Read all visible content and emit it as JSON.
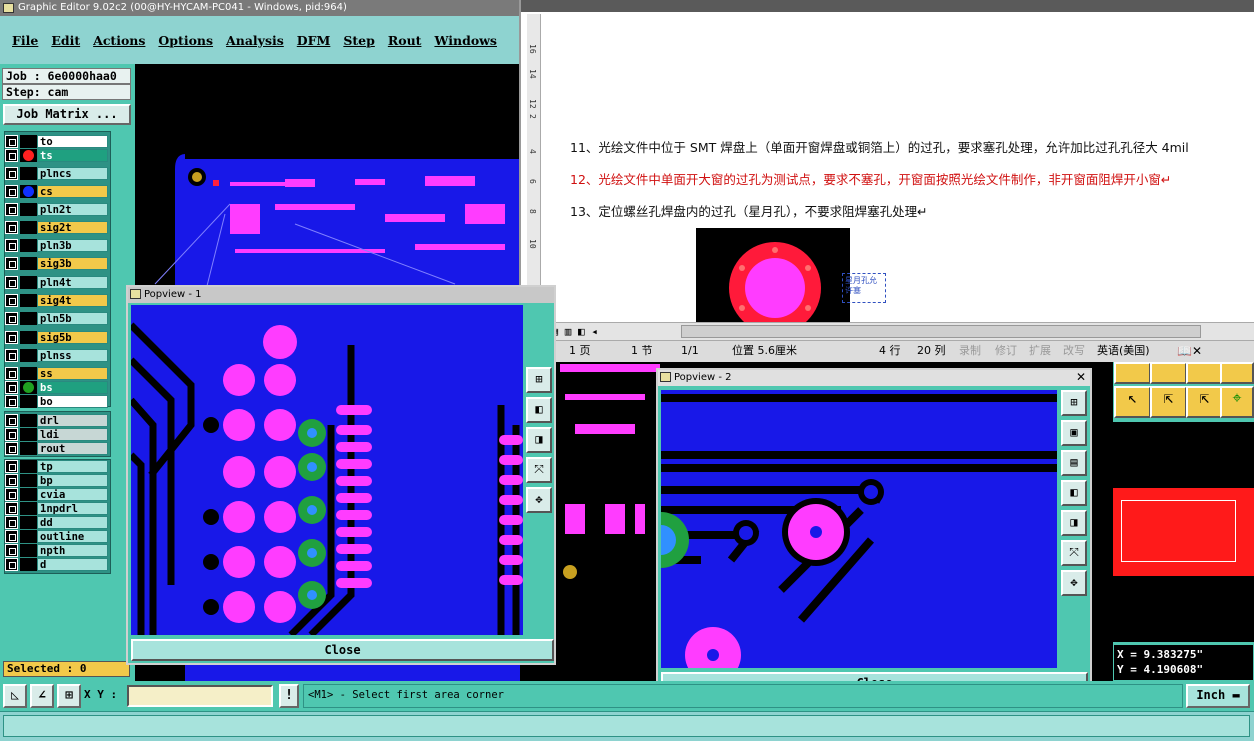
{
  "app": {
    "title": "Graphic Editor 9.02c2 (00@HY-HYCAM-PC041 - Windows, pid:964)"
  },
  "menu": [
    "File",
    "Edit",
    "Actions",
    "Options",
    "Analysis",
    "DFM",
    "Step",
    "Rout",
    "Windows"
  ],
  "job": {
    "job_label": "Job : 6e0000haa0",
    "step_label": "Step: cam",
    "matrix_button": "Job Matrix ..."
  },
  "layers": [
    {
      "name": "to",
      "style": "w",
      "color": "#000000"
    },
    {
      "name": "ts",
      "style": "g",
      "color": "#ff2020"
    },
    {
      "name": "plncs",
      "style": "n",
      "color": "#000000"
    },
    {
      "name": "cs",
      "style": "y",
      "color": "#1030ff"
    },
    {
      "name": "pln2t",
      "style": "n",
      "color": "#000000"
    },
    {
      "name": "sig2t",
      "style": "y",
      "color": "#000000"
    },
    {
      "name": "pln3b",
      "style": "n",
      "color": "#000000"
    },
    {
      "name": "sig3b",
      "style": "y",
      "color": "#000000"
    },
    {
      "name": "pln4t",
      "style": "n",
      "color": "#000000"
    },
    {
      "name": "sig4t",
      "style": "y",
      "color": "#000000"
    },
    {
      "name": "pln5b",
      "style": "n",
      "color": "#000000"
    },
    {
      "name": "sig5b",
      "style": "y",
      "color": "#000000"
    },
    {
      "name": "plnss",
      "style": "n",
      "color": "#000000"
    },
    {
      "name": "ss",
      "style": "y",
      "color": "#000000"
    },
    {
      "name": "bs",
      "style": "g",
      "color": "#20a020"
    },
    {
      "name": "bo",
      "style": "w",
      "color": "#000000"
    },
    {
      "name": "drl",
      "style": "gr",
      "color": "#000000"
    },
    {
      "name": "ldi",
      "style": "gr",
      "color": "#000000"
    },
    {
      "name": "rout",
      "style": "gr",
      "color": "#000000"
    },
    {
      "name": "tp",
      "style": "n",
      "color": "#000000"
    },
    {
      "name": "bp",
      "style": "n",
      "color": "#000000"
    },
    {
      "name": "cvia",
      "style": "n",
      "color": "#000000"
    },
    {
      "name": "1npdrl",
      "style": "n",
      "color": "#000000"
    },
    {
      "name": "dd",
      "style": "n",
      "color": "#000000"
    },
    {
      "name": "outline",
      "style": "n",
      "color": "#000000"
    },
    {
      "name": "npth",
      "style": "n",
      "color": "#000000"
    },
    {
      "name": "d",
      "style": "n",
      "color": "#000000"
    }
  ],
  "selected": "Selected : 0",
  "popview1": {
    "title": "Popview - 1",
    "close": "Close"
  },
  "popview2": {
    "title": "Popview - 2",
    "close": "Close"
  },
  "doc": {
    "lines": [
      "11、光绘文件中位于 SMT 焊盘上（单面开窗焊盘或铜箔上）的过孔，要求塞孔处理，允许加比过孔孔径大 4mil",
      "12、光绘文件中单面开大窗的过孔为测试点，要求不塞孔，开窗面按照光绘文件制作，非开窗面阻焊开小窗↵",
      "13、定位螺丝孔焊盘内的过孔（星月孔），不要求阻焊塞孔处理↵"
    ],
    "annotation": "星月孔允许塞",
    "ruler_marks": [
      "16",
      "14",
      "12",
      "2",
      "4",
      "6",
      "8",
      "10"
    ],
    "status": {
      "page": "1 页",
      "section": "1 节",
      "pages": "1/1",
      "position": "位置 5.6厘米",
      "line": "4 行",
      "col": "20 列",
      "rec": "录制",
      "rev": "修订",
      "ext": "扩展",
      "ovr": "改写",
      "lang": "英语(美国)"
    }
  },
  "coords": {
    "x": "X = 9.383275\"",
    "y": "Y = 4.190608\""
  },
  "bottom": {
    "xy_label": "X Y :",
    "xy_value": "",
    "prompt": "<M1> - Select first area corner",
    "units": "Inch"
  }
}
